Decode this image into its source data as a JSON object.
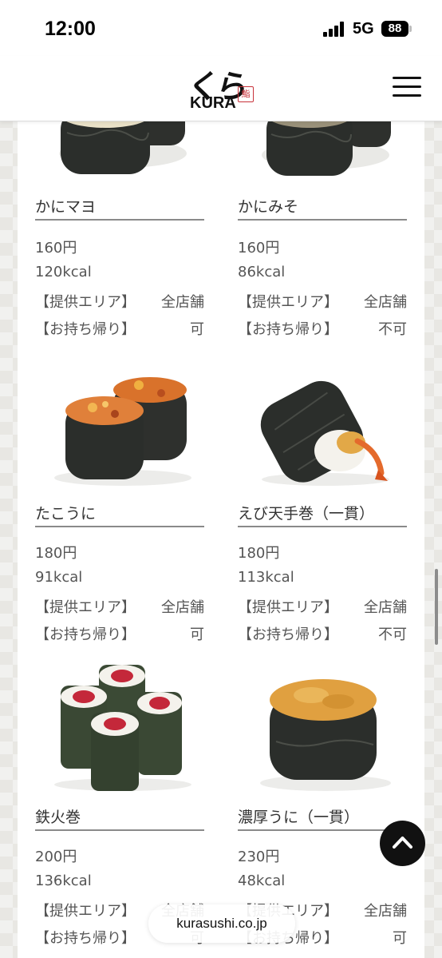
{
  "status_bar": {
    "time": "12:00",
    "network": "5G",
    "battery": "88"
  },
  "header": {
    "logo_kana": "くら",
    "logo_latin": "KURA",
    "logo_seal": "鮨",
    "menu_icon": "hamburger-menu-icon"
  },
  "labels": {
    "area": "【提供エリア】",
    "takeout": "【お持ち帰り】"
  },
  "items": [
    {
      "name": "かにマヨ",
      "price": "160円",
      "kcal": "120kcal",
      "area": "全店舗",
      "takeout": "可"
    },
    {
      "name": "かにみそ",
      "price": "160円",
      "kcal": "86kcal",
      "area": "全店舗",
      "takeout": "不可"
    },
    {
      "name": "たこうに",
      "price": "180円",
      "kcal": "91kcal",
      "area": "全店舗",
      "takeout": "可"
    },
    {
      "name": "えび天手巻（一貫）",
      "price": "180円",
      "kcal": "113kcal",
      "area": "全店舗",
      "takeout": "不可"
    },
    {
      "name": "鉄火巻",
      "price": "200円",
      "kcal": "136kcal",
      "area": "全店舗",
      "takeout": "可"
    },
    {
      "name": "濃厚うに（一貫）",
      "price": "230円",
      "kcal": "48kcal",
      "area": "全店舗",
      "takeout": "可"
    }
  ],
  "back_to_top_icon": "chevron-up-icon",
  "url": "kurasushi.co.jp",
  "colors": {
    "nori": "#2b2e2b",
    "rice": "#f4f2ec",
    "tuna": "#c4283a",
    "uni": "#e0a040",
    "tempura": "#e2a847",
    "shrimp": "#e46a2c"
  }
}
